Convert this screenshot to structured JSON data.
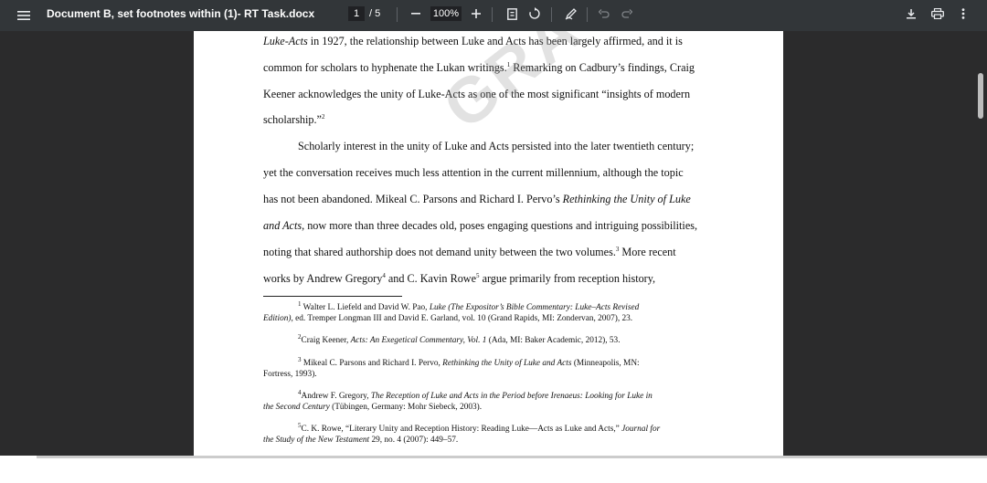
{
  "toolbar": {
    "title": "Document B, set footnotes within (1)- RT Task.docx",
    "page_current": "1",
    "page_total": "/ 5",
    "zoom": "100%",
    "icons": [
      "menu-icon",
      "zoom-out-icon",
      "zoom-in-icon",
      "fit-page-icon",
      "rotate-icon",
      "annotate-icon",
      "undo-icon",
      "redo-icon",
      "download-icon",
      "print-icon",
      "more-icon"
    ]
  },
  "document": {
    "watermark": "GRACE",
    "lines": [
      {
        "pre_italic": "Luke-Acts",
        "text": " in 1927, the relationship between Luke and Acts has been largely affirmed, and it is"
      },
      {
        "text": "common for scholars to hyphenate the Lukan writings.",
        "sup": "1",
        "tail": " Remarking on Cadbury’s findings, Craig"
      },
      {
        "text": "Keener acknowledges the unity of Luke-Acts as one of the most significant “insights of modern"
      },
      {
        "text": "scholarship.”",
        "sup": "2"
      },
      {
        "text": "Scholarly interest in the unity of Luke and Acts persisted into the later twentieth century;"
      },
      {
        "text": "yet the conversation receives much less attention in the current millennium, although the topic"
      },
      {
        "text": "has not been abandoned. Mikeal C. Parsons and Richard I. Pervo’s ",
        "italic": "Rethinking the Unity of Luke"
      },
      {
        "pre_italic": "and Acts",
        "text": ", now more than three decades old, poses engaging questions and intriguing possibilities,"
      },
      {
        "text": "noting that shared authorship does not demand unity between the two volumes.",
        "sup": "3",
        "tail": " More recent"
      },
      {
        "text": "works by Andrew Gregory",
        "sup": "4",
        "tail": " and C. Kavin Rowe",
        "sup2": "5",
        "tail2": " argue primarily from reception history,"
      }
    ],
    "footnotes": [
      {
        "num": "1",
        "line1_a": " Walter L. Liefeld and David W. Pao, ",
        "line1_i": "Luke (The Expositor’s Bible Commentary: Luke–Acts Revised",
        "line2_i": "Edition)",
        "line2_a": ", ed. Tremper Longman III and David E. Garland, vol. 10 (Grand Rapids, MI: Zondervan, 2007), 23."
      },
      {
        "num": "2",
        "line1_a": "Craig Keener, ",
        "line1_i": "Acts: An Exegetical Commentary, Vol. 1",
        "line1_b": " (Ada, MI: Baker Academic, 2012), 53."
      },
      {
        "num": "3",
        "line1_a": " Mikeal C. Parsons and Richard I. Pervo, ",
        "line1_i": "Rethinking the Unity of Luke and Acts",
        "line1_b": " (Minneapolis, MN:",
        "line2_a": "Fortress, 1993)."
      },
      {
        "num": "4",
        "line1_a": "Andrew F. Gregory, ",
        "line1_i": "The Reception of Luke and Acts in the Period before Irenaeus: Looking for Luke in",
        "line2_i": "the Second Century",
        "line2_a": " (Tübingen, Germany: Mohr Siebeck, 2003)."
      },
      {
        "num": "5",
        "line1_a": "C. K. Rowe, “Literary Unity and Reception History: Reading Luke—Acts as Luke and Acts,” ",
        "line1_i": "Journal for",
        "line2_i": "the Study of the New Testament",
        "line2_a": " 29, no. 4 (2007): 449–57."
      }
    ]
  }
}
